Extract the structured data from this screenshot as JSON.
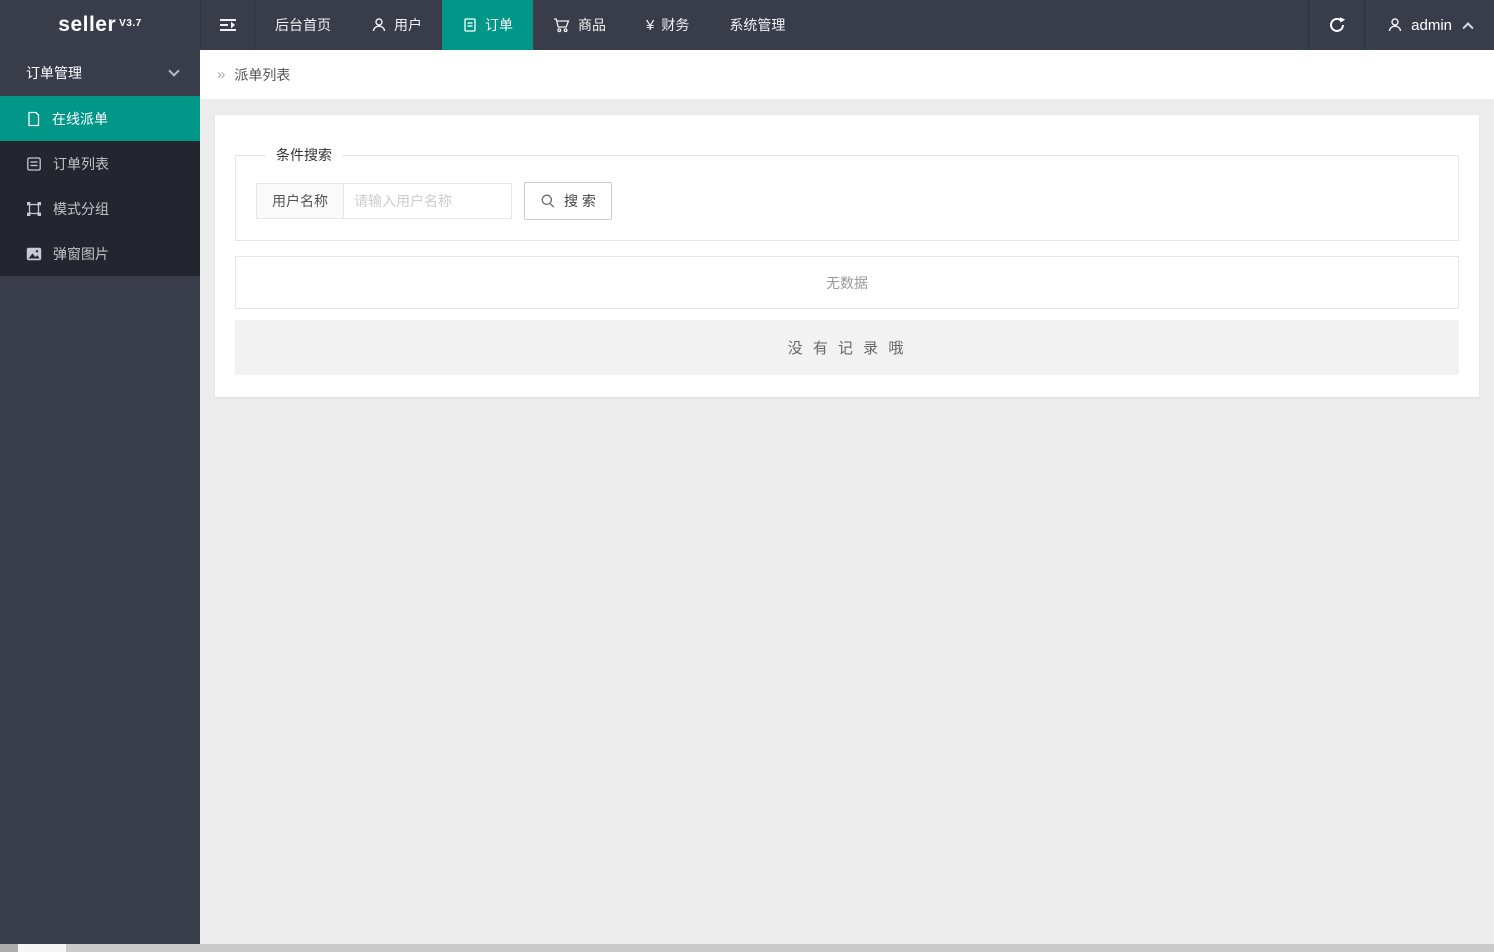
{
  "brand": {
    "name": "seller",
    "version": "V3.7"
  },
  "icons": {
    "yen": "¥",
    "double_arrow": "»"
  },
  "topnav": {
    "items": [
      {
        "label": "后台首页",
        "icon": null,
        "active": false
      },
      {
        "label": "用户",
        "icon": "user-icon",
        "active": false
      },
      {
        "label": "订单",
        "icon": "file-icon",
        "active": true
      },
      {
        "label": "商品",
        "icon": "cart-icon",
        "active": false
      },
      {
        "label": "财务",
        "icon": "yen-icon",
        "active": false
      },
      {
        "label": "系统管理",
        "icon": null,
        "active": false
      }
    ],
    "admin_label": "admin"
  },
  "sidebar": {
    "group_label": "订单管理",
    "items": [
      {
        "label": "在线派单",
        "icon": "dispatch-file-icon",
        "active": true
      },
      {
        "label": "订单列表",
        "icon": "order-list-icon",
        "active": false
      },
      {
        "label": "模式分组",
        "icon": "group-icon",
        "active": false
      },
      {
        "label": "弹窗图片",
        "icon": "image-icon",
        "active": false
      }
    ]
  },
  "breadcrumb": {
    "current": "派单列表"
  },
  "search": {
    "legend": "条件搜索",
    "label": "用户名称",
    "placeholder": "请输入用户名称",
    "button_label": "搜 索"
  },
  "results": {
    "empty_text": "无数据",
    "no_record_text": "没 有 记 录 哦"
  },
  "colors": {
    "accent": "#009688",
    "header_bg": "#393D49",
    "menu_bg": "#23262F",
    "content_bg": "#ececec"
  }
}
